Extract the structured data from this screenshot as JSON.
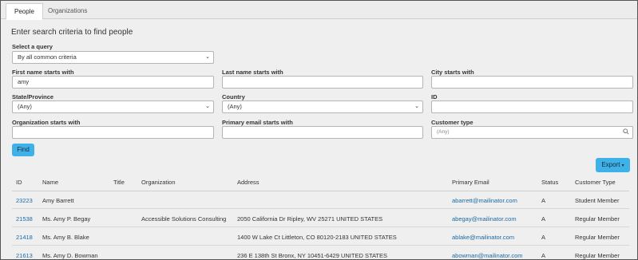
{
  "tabs": [
    {
      "label": "People",
      "active": true
    },
    {
      "label": "Organizations",
      "active": false
    }
  ],
  "heading": "Enter search criteria to find people",
  "query": {
    "label": "Select a query",
    "value": "By all common criteria"
  },
  "fields": {
    "first_name": {
      "label": "First name starts with",
      "value": "amy"
    },
    "last_name": {
      "label": "Last name starts with",
      "value": ""
    },
    "city": {
      "label": "City starts with",
      "value": ""
    },
    "state": {
      "label": "State/Province",
      "value": "(Any)"
    },
    "country": {
      "label": "Country",
      "value": "(Any)"
    },
    "id": {
      "label": "ID",
      "value": ""
    },
    "organization": {
      "label": "Organization starts with",
      "value": ""
    },
    "email": {
      "label": "Primary email starts with",
      "value": ""
    },
    "customer_type": {
      "label": "Customer type",
      "placeholder": "(Any)"
    }
  },
  "find_label": "Find",
  "export_label": "Export",
  "table": {
    "headers": {
      "id": "ID",
      "name": "Name",
      "title": "Title",
      "organization": "Organization",
      "address": "Address",
      "email": "Primary Email",
      "status": "Status",
      "type": "Customer Type"
    },
    "rows": [
      {
        "id": "23223",
        "name": "Amy Barrett",
        "title": "",
        "organization": "",
        "address": "",
        "email": "abarrett@mailinator.com",
        "status": "A",
        "type": "Student Member"
      },
      {
        "id": "21538",
        "name": "Ms. Amy P. Begay",
        "title": "",
        "organization": "Accessible Solutions Consulting",
        "address": "2050 California Dr Ripley, WV 25271 UNITED STATES",
        "email": "abegay@mailinator.com",
        "status": "A",
        "type": "Regular Member"
      },
      {
        "id": "21418",
        "name": "Ms. Amy B. Blake",
        "title": "",
        "organization": "",
        "address": "1400 W Lake Ct Littleton, CO 80120-2183 UNITED STATES",
        "email": "ablake@mailinator.com",
        "status": "A",
        "type": "Regular Member"
      },
      {
        "id": "21613",
        "name": "Ms. Amy D. Bowman",
        "title": "",
        "organization": "",
        "address": "236 E 138th St Bronx, NY 10451-6429 UNITED STATES",
        "email": "abowman@mailinator.com",
        "status": "A",
        "type": "Regular Member"
      }
    ]
  }
}
